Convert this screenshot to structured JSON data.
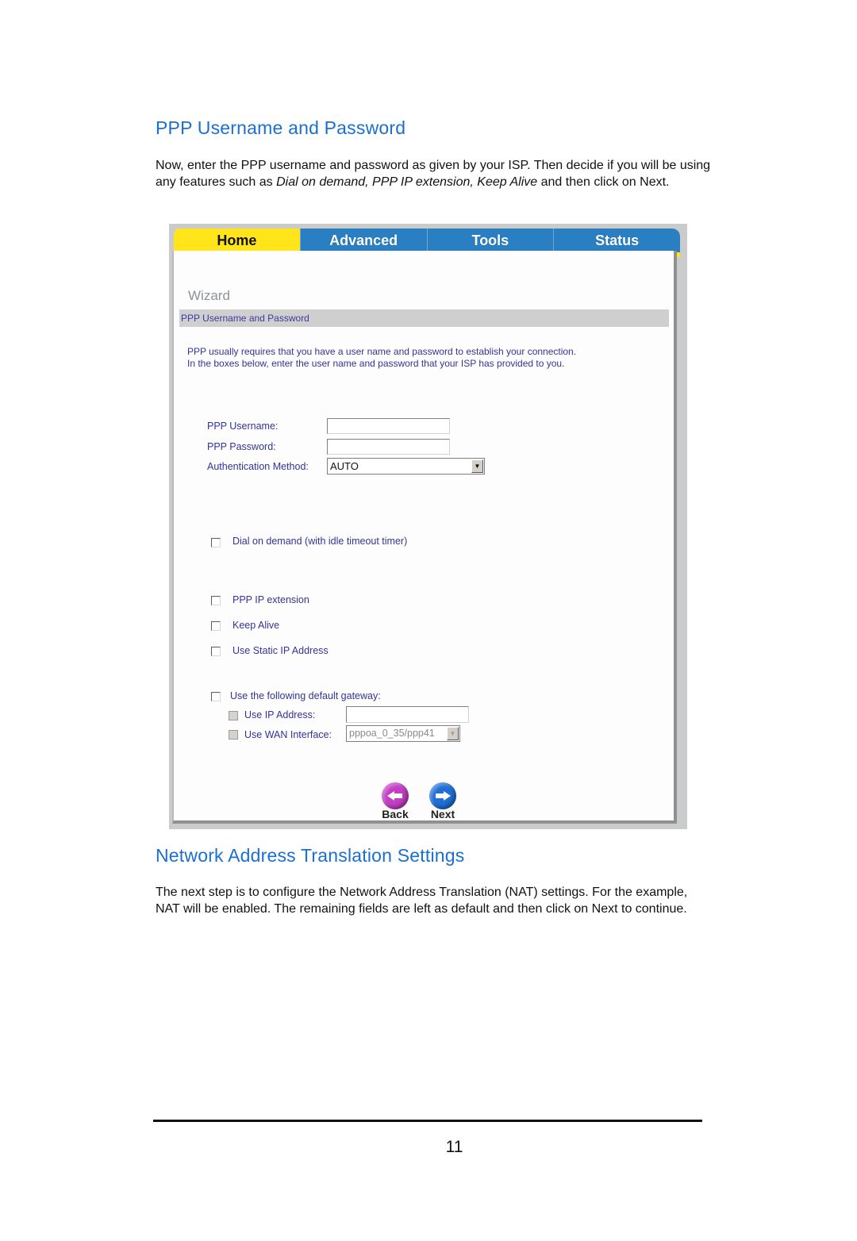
{
  "section1": {
    "heading": "PPP Username and Password",
    "paragraph": {
      "part1": "Now, enter the PPP username and password as given by your ISP.  Then decide if you will be using any features such as ",
      "italic": "Dial on demand, PPP IP extension, Keep Alive",
      "part2": " and then click on Next."
    }
  },
  "screenshot": {
    "tabs": [
      {
        "label": "Home",
        "active": true
      },
      {
        "label": "Advanced",
        "active": false
      },
      {
        "label": "Tools",
        "active": false
      },
      {
        "label": "Status",
        "active": false
      }
    ],
    "wizard_title": "Wizard",
    "section_title": "PPP Username and Password",
    "intro_line1": "PPP usually requires that you have a user name and password to establish your connection.",
    "intro_line2": "In the boxes below, enter the user name and password that your ISP has provided to you.",
    "fields": {
      "username_label": "PPP Username:",
      "username_value": "",
      "password_label": "PPP Password:",
      "password_value": "",
      "auth_label": "Authentication Method:",
      "auth_value": "AUTO"
    },
    "checkboxes": {
      "dial_on_demand": {
        "label": "Dial on demand (with idle timeout timer)",
        "checked": false
      },
      "ppp_ip_extension": {
        "label": "PPP IP extension",
        "checked": false
      },
      "keep_alive": {
        "label": "Keep Alive",
        "checked": false
      },
      "static_ip": {
        "label": "Use Static IP Address",
        "checked": false
      },
      "default_gateway": {
        "label": "Use the following default gateway:",
        "checked": false
      },
      "use_ip_address": {
        "label": "Use IP Address:",
        "checked": false,
        "value": ""
      },
      "use_wan_interface": {
        "label": "Use WAN Interface:",
        "checked": false,
        "value": "pppoa_0_35/ppp41"
      }
    },
    "buttons": {
      "back": "Back",
      "next": "Next"
    },
    "colors": {
      "tab_active": "#ffe51a",
      "tab_inactive": "#2a7fc3",
      "label_text": "#33339a"
    }
  },
  "section2": {
    "heading": "Network Address Translation Settings",
    "paragraph": "The next step is to configure the Network Address Translation (NAT) settings.  For the example, NAT will be enabled.  The remaining fields are left as default and then click on Next to continue."
  },
  "footer": {
    "page_number": "11"
  }
}
